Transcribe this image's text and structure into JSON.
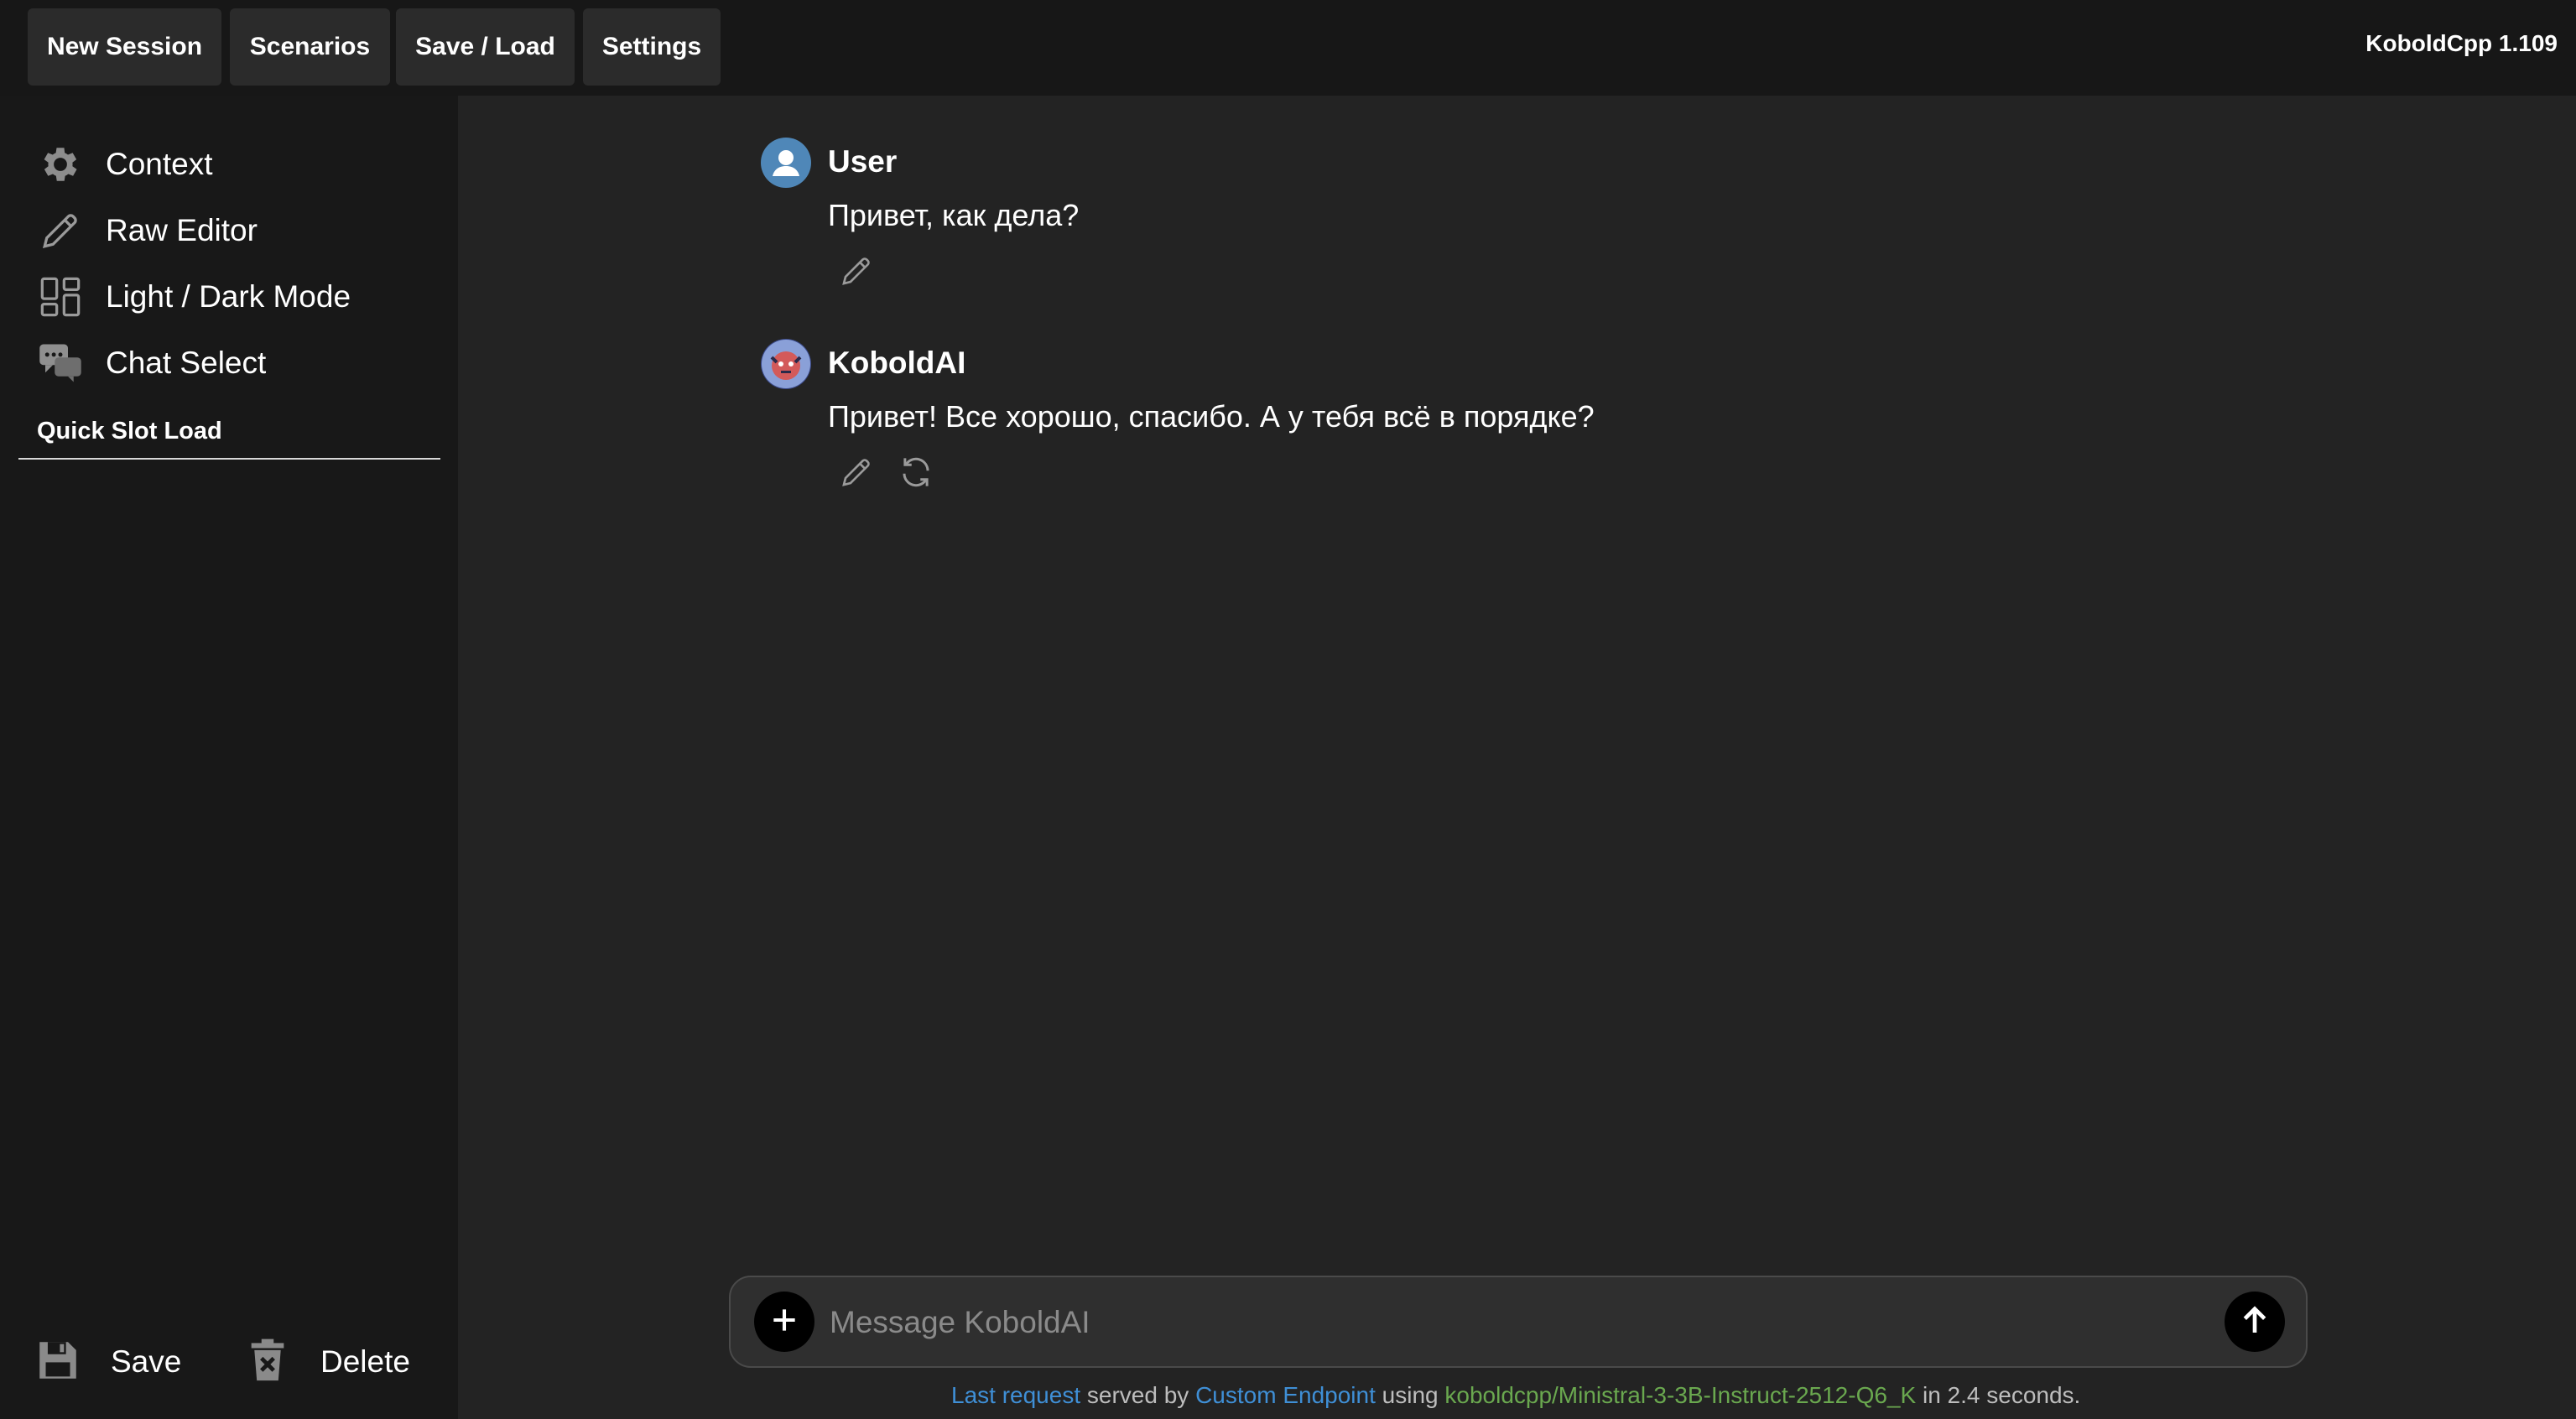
{
  "topbar": {
    "buttons": [
      "New Session",
      "Scenarios",
      "Save / Load",
      "Settings"
    ],
    "version": "KoboldCpp 1.109"
  },
  "sidebar": {
    "items": [
      {
        "label": "Context",
        "icon": "gear-icon"
      },
      {
        "label": "Raw Editor",
        "icon": "pencil-icon"
      },
      {
        "label": "Light / Dark Mode",
        "icon": "layout-icon"
      },
      {
        "label": "Chat Select",
        "icon": "chat-bubbles-icon"
      }
    ],
    "quick_slot_title": "Quick Slot Load",
    "save_label": "Save",
    "delete_label": "Delete"
  },
  "chat": {
    "messages": [
      {
        "name": "User",
        "text": "Привет, как дела?"
      },
      {
        "name": "KoboldAI",
        "text": "Привет! Все хорошо, спасибо. А у тебя всё в порядке?"
      }
    ]
  },
  "input": {
    "placeholder": "Message KoboldAI"
  },
  "status": {
    "last_request": "Last request",
    "served_by": "served by",
    "endpoint": "Custom Endpoint",
    "using": "using",
    "model": "koboldcpp/Ministral-3-3B-Instruct-2512-Q6_K",
    "time": "in 2.4 seconds."
  },
  "colors": {
    "link": "#3f8fd6",
    "model": "#6aa84f",
    "user_avatar": "#4f87b8"
  }
}
